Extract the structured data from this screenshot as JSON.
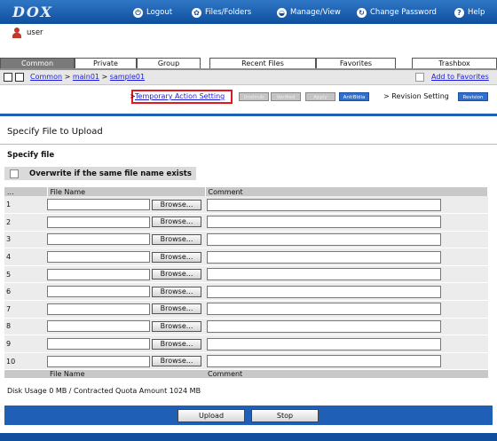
{
  "app": {
    "logo": "DOX"
  },
  "topnav": [
    {
      "label": "Logout",
      "icon": "logout-icon",
      "glyph": "⏻"
    },
    {
      "label": "Files/Folders",
      "icon": "files-folders-icon",
      "glyph": "✿"
    },
    {
      "label": "Manage/View",
      "icon": "manage-view-icon",
      "glyph": "◒"
    },
    {
      "label": "Change Password",
      "icon": "change-password-icon",
      "glyph": "↻"
    },
    {
      "label": "Help",
      "icon": "help-icon",
      "glyph": "?"
    }
  ],
  "user": {
    "name": "user"
  },
  "tabs": {
    "common": "Common",
    "private": "Private",
    "group": "Group",
    "recent": "Recent Files",
    "favorites": "Favorites",
    "trash": "Trashbox"
  },
  "breadcrumb": {
    "root": "Common",
    "level1": "main01",
    "level2": "sample01",
    "sep": ">",
    "add_favorites": "Add to Favorites"
  },
  "actions": {
    "prefix": ">",
    "temporary": "Temporary Action Setting",
    "chips": [
      "Unshrub",
      "Varified",
      "Apply",
      "AntiBIdia"
    ],
    "revision_prefix": "> Revision Setting",
    "revision_chip": "Revision"
  },
  "page": {
    "title": "Specify File to Upload",
    "specify": "Specify file",
    "overwrite": "Overwrite if the same file name exists"
  },
  "table": {
    "head_num": "...",
    "head_file": "File Name",
    "head_comment": "Comment",
    "browse": "Browse...",
    "rows": [
      "1",
      "2",
      "3",
      "4",
      "5",
      "6",
      "7",
      "8",
      "9",
      "10"
    ]
  },
  "disk": "Disk Usage 0 MB / Contracted Quota Amount 1024 MB",
  "buttons": {
    "upload": "Upload",
    "stop": "Stop"
  },
  "colors": {
    "brand_blue": "#1f5fb5",
    "highlight_red": "#e0191f"
  }
}
